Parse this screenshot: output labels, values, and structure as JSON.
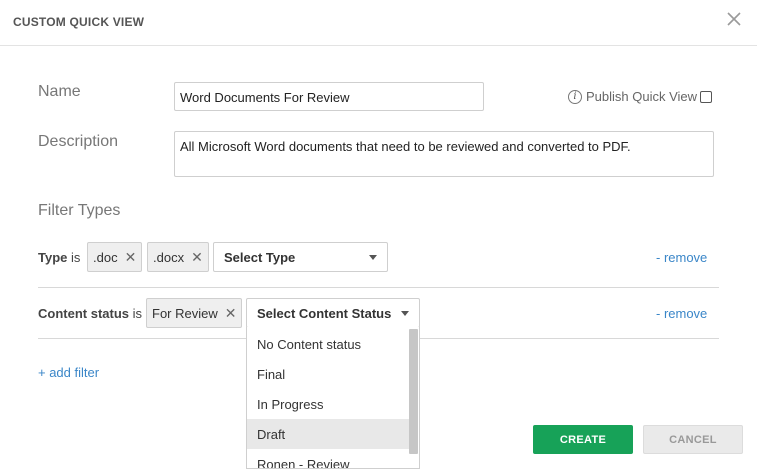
{
  "dialog": {
    "title": "CUSTOM QUICK VIEW"
  },
  "form": {
    "name_label": "Name",
    "name_value": "Word Documents For Review",
    "description_label": "Description",
    "description_value": "All Microsoft Word documents that need to be reviewed and converted to PDF.",
    "publish_label": "Publish Quick View",
    "publish_checked": false
  },
  "filters": {
    "heading": "Filter Types",
    "rows": [
      {
        "field": "Type",
        "op": "is",
        "chips": [
          ".doc",
          ".docx"
        ],
        "select_label": "Select Type",
        "remove_label": "- remove"
      },
      {
        "field": "Content status",
        "op": "is",
        "chips": [
          "For Review"
        ],
        "select_label": "Select Content Status",
        "remove_label": "- remove"
      }
    ],
    "add_label": "+ add filter"
  },
  "dropdown": {
    "options": [
      "No Content status",
      "Final",
      "In Progress",
      "Draft",
      "Ronen - Review"
    ],
    "highlighted": "Draft"
  },
  "buttons": {
    "create": "CREATE",
    "cancel": "CANCEL"
  },
  "icons": {
    "close": "close-icon",
    "info": "info-icon",
    "chip_remove": "x-icon",
    "dropdown_caret": "caret-down-icon"
  },
  "colors": {
    "accent_link": "#3a86c8",
    "create_button": "#17a258",
    "highlight_option": "#e8e8e8"
  }
}
